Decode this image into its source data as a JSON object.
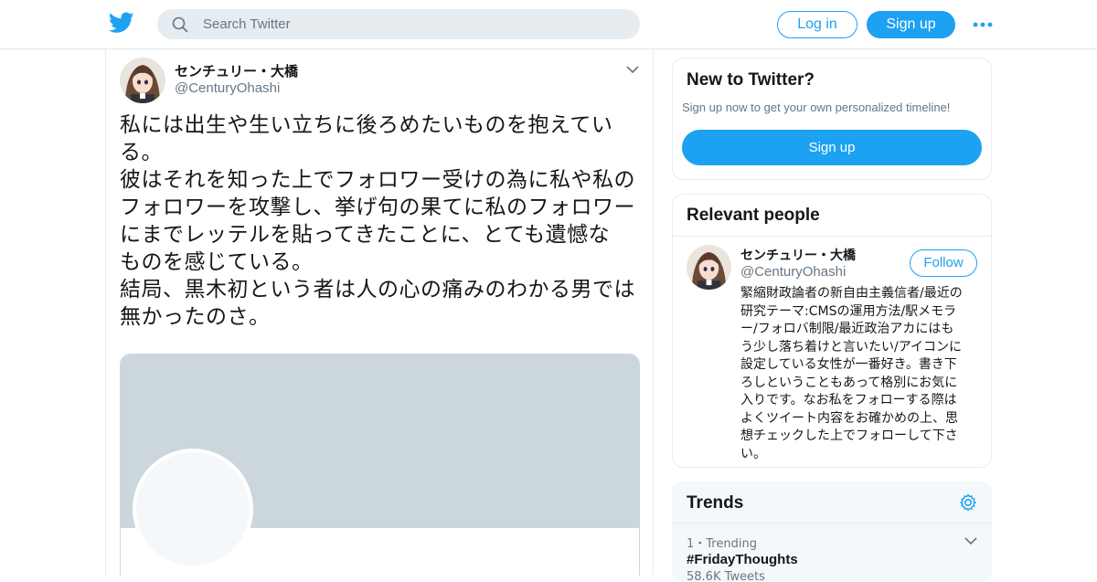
{
  "colors": {
    "accent": "#1da1f2",
    "muted": "#657786",
    "text": "#14171a",
    "banner": "#ccd6dd"
  },
  "header": {
    "logo_icon": "twitter-bird-icon",
    "search_placeholder": "Search Twitter",
    "login_label": "Log in",
    "signup_label": "Sign up",
    "more_icon": "more-dots-icon"
  },
  "tweet": {
    "author_name": "センチュリー・大橋",
    "author_handle": "@CenturyOhashi",
    "text_lines": [
      "私には出生や生い立ちに後ろめたいものを抱えてい",
      "る。",
      "彼はそれを知った上でフォロワー受けの為に私や私の",
      "フォロワーを攻撃し、挙げ句の果てに私のフォロワー",
      "にまでレッテルを貼ってきたことに、とても遺憾な",
      "ものを感じている。",
      "結局、黒木初という者は人の心の痛みのわかる男では",
      "無かったのさ。"
    ]
  },
  "new_to_twitter": {
    "title": "New to Twitter?",
    "subtitle": "Sign up now to get your own personalized timeline!",
    "signup_label": "Sign up"
  },
  "relevant_people": {
    "title": "Relevant people",
    "name": "センチュリー・大橋",
    "handle": "@CenturyOhashi",
    "follow_label": "Follow",
    "bio_lines": [
      "緊縮財政論者の新自由主義信者/最近の",
      "研究テーマ:CMSの運用方法/駅メモラ",
      "ー/フォロバ制限/最近政治アカにはも",
      "う少し落ち着けと言いたい/アイコンに",
      "設定している女性が一番好き。書き下",
      "ろしということもあって格別にお気に",
      "入りです。なお私をフォローする際は",
      "よくツイート内容をお確かめの上、思",
      "想チェックした上でフォローして下さ",
      "い。"
    ]
  },
  "trends": {
    "title": "Trends",
    "items": [
      {
        "meta": "1・Trending",
        "name": "#FridayThoughts",
        "count": "58.6K Tweets"
      }
    ]
  }
}
